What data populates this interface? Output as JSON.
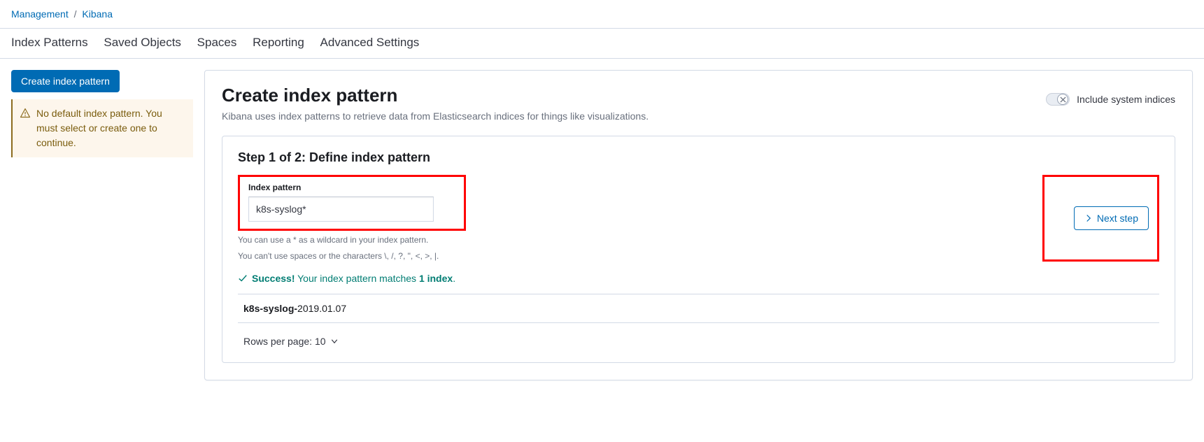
{
  "breadcrumb": {
    "root": "Management",
    "current": "Kibana"
  },
  "tabs": {
    "items": [
      "Index Patterns",
      "Saved Objects",
      "Spaces",
      "Reporting",
      "Advanced Settings"
    ]
  },
  "sidebar": {
    "create_button": "Create index pattern",
    "callout": "No default index pattern. You must select or create one to continue."
  },
  "header": {
    "title": "Create index pattern",
    "subtitle": "Kibana uses index patterns to retrieve data from Elasticsearch indices for things like visualizations.",
    "system_indices_label": "Include system indices"
  },
  "step": {
    "title": "Step 1 of 2: Define index pattern",
    "field_label": "Index pattern",
    "input_value": "k8s-syslog*",
    "help1": "You can use a * as a wildcard in your index pattern.",
    "help2": "You can't use spaces or the characters \\, /, ?, \", <, >, |.",
    "success_prefix": "Success!",
    "success_mid": "Your index pattern matches",
    "success_count": "1 index",
    "next_button": "Next step"
  },
  "indices": [
    {
      "bold": "k8s-syslog-",
      "rest": "2019.01.07"
    }
  ],
  "pager": {
    "label": "Rows per page: 10"
  }
}
